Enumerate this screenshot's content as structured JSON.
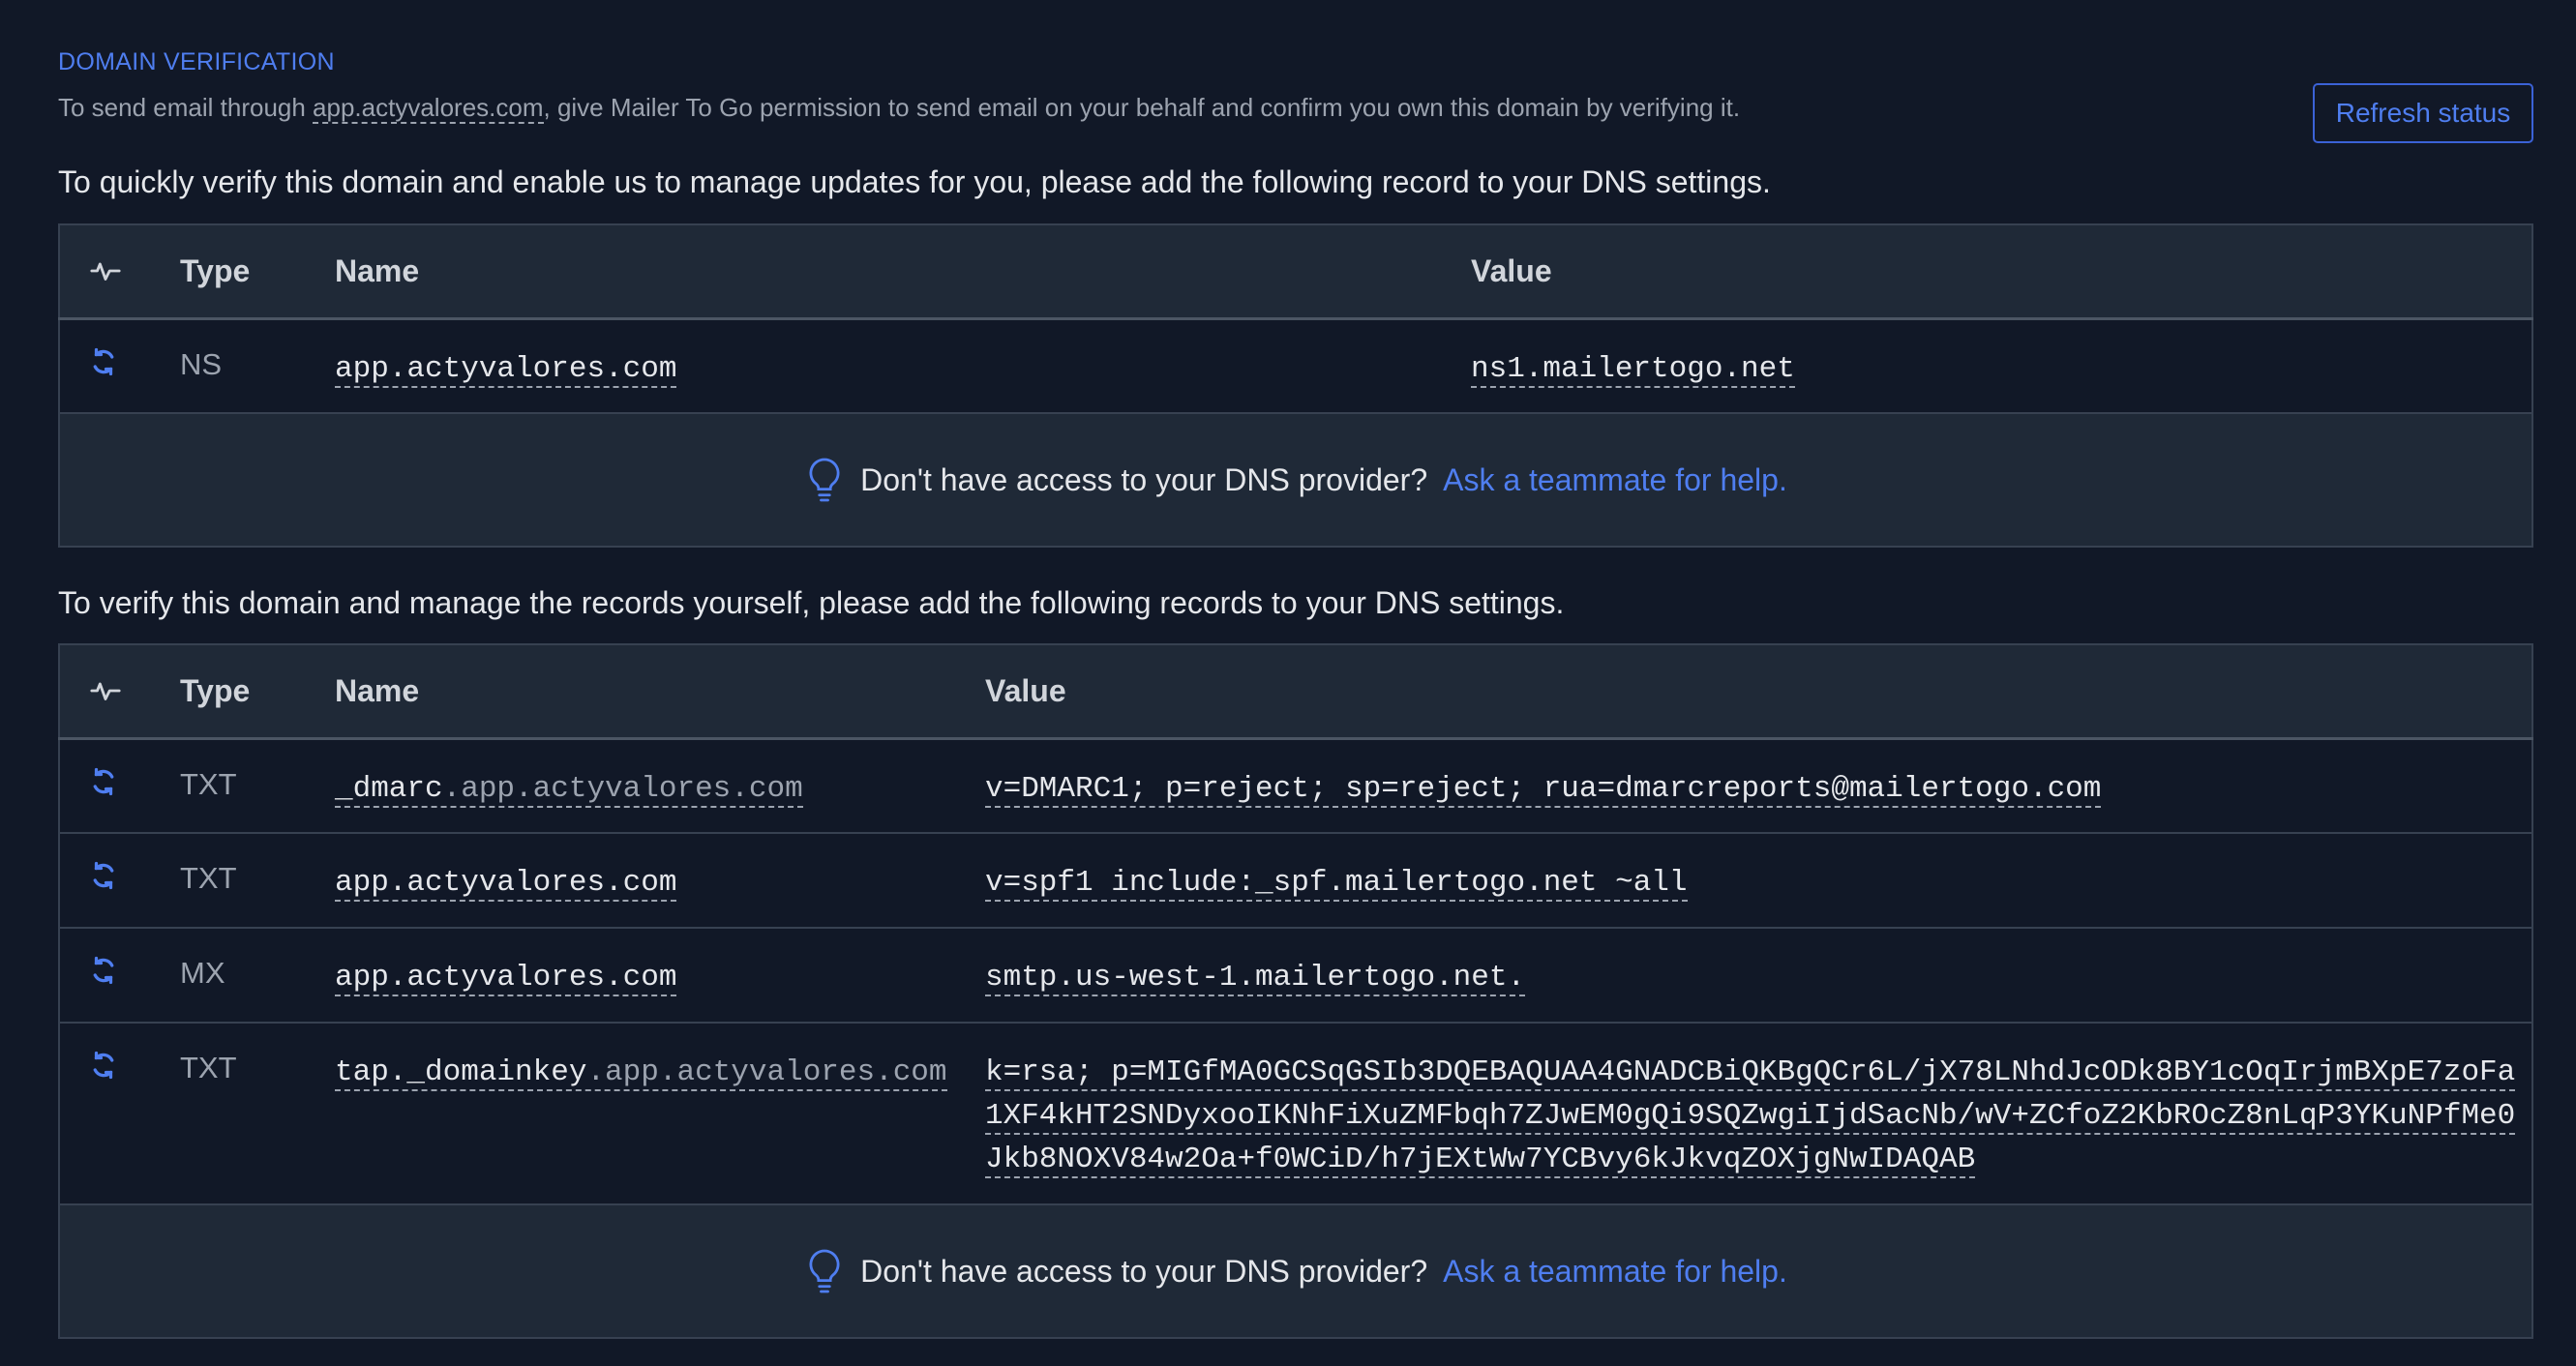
{
  "header": {
    "section_title": "DOMAIN VERIFICATION",
    "subtitle_prefix": "To send email through ",
    "subtitle_domain": "app.actyvalores.com",
    "subtitle_suffix": ", give Mailer To Go permission to send email on your behalf and confirm you own this domain by verifying it.",
    "refresh_button": "Refresh status"
  },
  "quick_verify": {
    "intro": "To quickly verify this domain and enable us to manage updates for you, please add the following record to your DNS settings.",
    "columns": {
      "status_icon": "activity-icon",
      "type": "Type",
      "name": "Name",
      "value": "Value"
    },
    "records": [
      {
        "status_icon": "refresh-icon",
        "type": "NS",
        "name": "app.actyvalores.com",
        "value": "ns1.mailertogo.net"
      }
    ],
    "help": {
      "icon": "lightbulb-icon",
      "text": "Don't have access to your DNS provider?",
      "link": "Ask a teammate for help."
    }
  },
  "manual_verify": {
    "intro": "To verify this domain and manage the records yourself, please add the following records to your DNS settings.",
    "columns": {
      "status_icon": "activity-icon",
      "type": "Type",
      "name": "Name",
      "value": "Value"
    },
    "records": [
      {
        "status_icon": "refresh-icon",
        "type": "TXT",
        "name_prefix": "_dmarc",
        "name_domain": ".app.actyvalores.com",
        "value": "v=DMARC1; p=reject; sp=reject; rua=dmarcreports@mailertogo.com"
      },
      {
        "status_icon": "refresh-icon",
        "type": "TXT",
        "name_prefix": "app.actyvalores.com",
        "name_domain": "",
        "value": "v=spf1 include:_spf.mailertogo.net ~all"
      },
      {
        "status_icon": "refresh-icon",
        "type": "MX",
        "name_prefix": "app.actyvalores.com",
        "name_domain": "",
        "value": "smtp.us-west-1.mailertogo.net."
      },
      {
        "status_icon": "refresh-icon",
        "type": "TXT",
        "name_prefix": "tap._domainkey",
        "name_domain": ".app.actyvalores.com",
        "value": "k=rsa; p=MIGfMA0GCSqGSIb3DQEBAQUAA4GNADCBiQKBgQCr6L/jX78LNhdJcODk8BY1cOqIrjmBXpE7zoFa1XF4kHT2SNDyxooIKNhFiXuZMFbqh7ZJwEM0gQi9SQZwgiIjdSacNb/wV+ZCfoZ2KbROcZ8nLqP3YKuNPfMe0Jkb8NOXV84w2Oa+f0WCiD/h7jEXtWw7YCBvy6kJkvqZOXjgNwIDAQAB"
      }
    ],
    "help": {
      "icon": "lightbulb-icon",
      "text": "Don't have access to your DNS provider?",
      "link": "Ask a teammate for help."
    }
  },
  "colors": {
    "background": "#111827",
    "panel": "#1f2937",
    "accent": "#4f7ef0"
  }
}
